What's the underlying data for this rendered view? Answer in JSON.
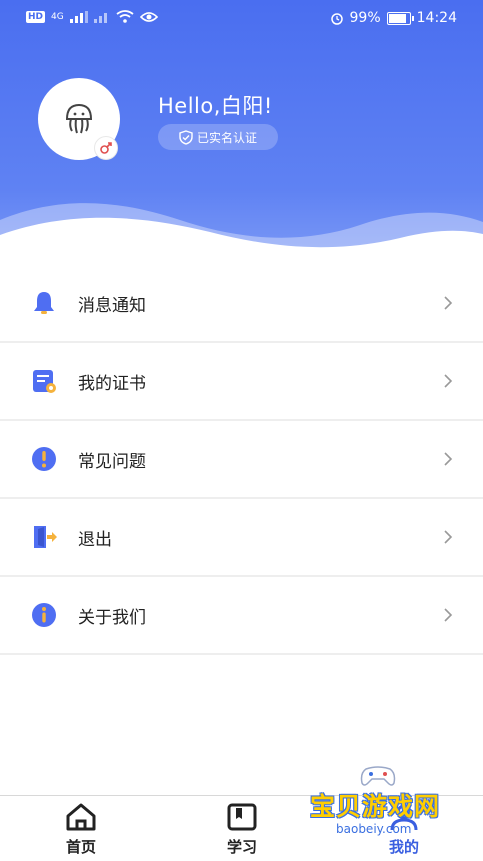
{
  "status_bar": {
    "left_badge": "HD",
    "network": "4G",
    "battery_percent": "99%",
    "battery_level": 0.99,
    "time": "14:24"
  },
  "profile": {
    "greeting": "Hello,白阳!",
    "verified_label": "已实名认证"
  },
  "menu": [
    {
      "label": "消息通知",
      "icon": "bell-icon"
    },
    {
      "label": "我的证书",
      "icon": "certificate-icon"
    },
    {
      "label": "常见问题",
      "icon": "question-icon"
    },
    {
      "label": "退出",
      "icon": "logout-icon"
    },
    {
      "label": "关于我们",
      "icon": "info-icon"
    }
  ],
  "tabbar": {
    "items": [
      {
        "label": "首页",
        "icon": "home-icon"
      },
      {
        "label": "学习",
        "icon": "book-icon"
      },
      {
        "label": "我的",
        "icon": "user-icon"
      }
    ],
    "active": "我的"
  },
  "watermark": {
    "title": "宝贝游戏网",
    "url": "baobeiy.com"
  },
  "colors": {
    "accent": "#4a6ef0",
    "icon_blue": "#4f6ef2",
    "icon_orange": "#f5b23c"
  }
}
